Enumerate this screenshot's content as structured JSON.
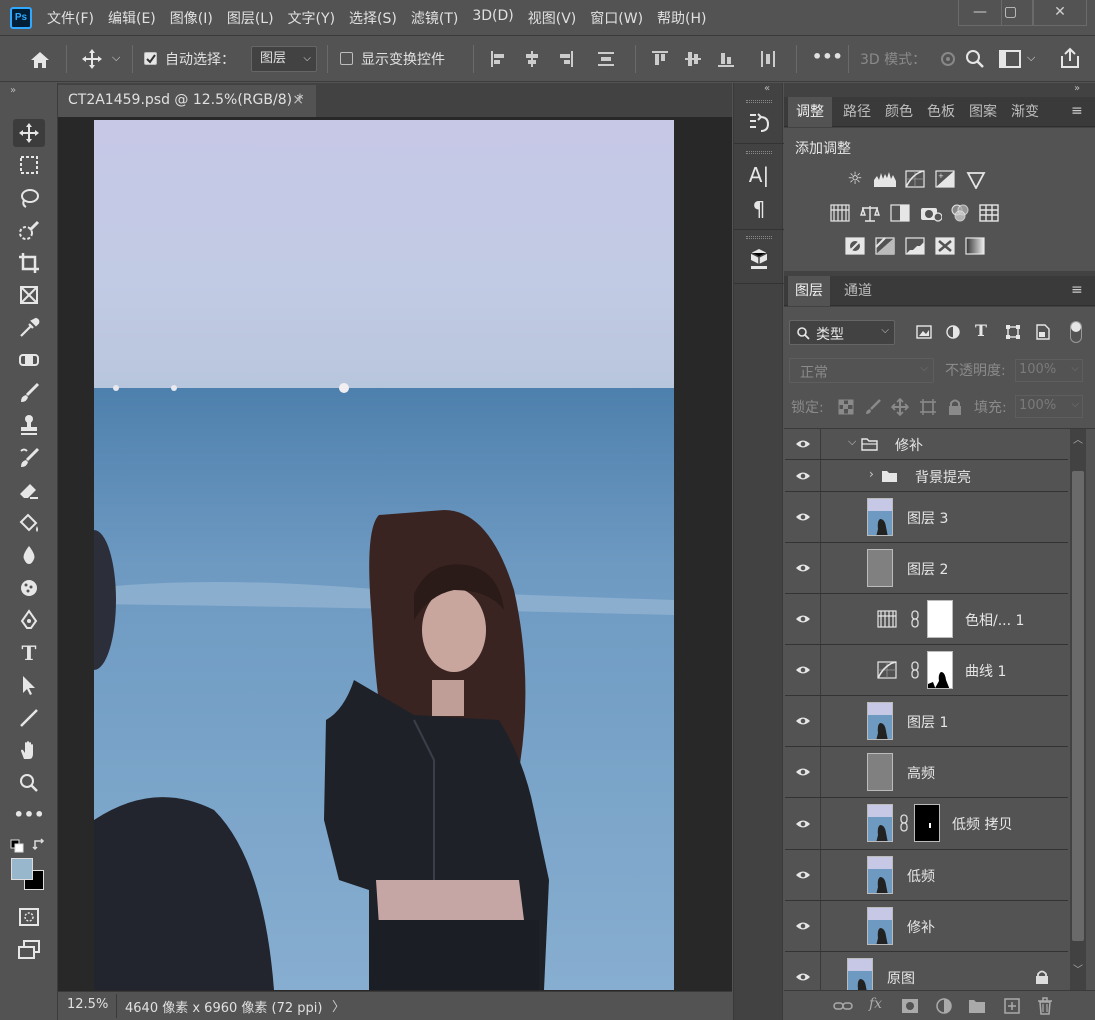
{
  "app": {
    "logo": "Ps"
  },
  "menu": [
    "文件(F)",
    "编辑(E)",
    "图像(I)",
    "图层(L)",
    "文字(Y)",
    "选择(S)",
    "滤镜(T)",
    "3D(D)",
    "视图(V)",
    "窗口(W)",
    "帮助(H)"
  ],
  "window_controls": {
    "minimize": "—",
    "restore": "▢",
    "close": "✕"
  },
  "options": {
    "auto_select_label": "自动选择：",
    "auto_select_checked": true,
    "auto_select_target": "图层",
    "show_transform_label": "显示变换控件",
    "show_transform_checked": false,
    "more": "•••",
    "mode_3d_label": "3D 模式："
  },
  "document": {
    "tab_title": "CT2A1459.psd @ 12.5%(RGB/8) *",
    "close": "×",
    "zoom": "12.5%",
    "info": "4640 像素 x 6960 像素 (72 ppi)",
    "info_arrow": "〉"
  },
  "colors": {
    "foreground": "#98b6cc",
    "background": "#000000",
    "accent": "#31a8ff"
  },
  "adjust_panel": {
    "tabs": [
      "调整",
      "路径",
      "颜色",
      "色板",
      "图案",
      "渐变"
    ],
    "active_tab": "调整",
    "title": "添加调整",
    "icons": [
      [
        "brightness-icon",
        "levels-icon",
        "curves-icon",
        "exposure-icon",
        "vibrance-icon"
      ],
      [
        "hue-saturation-icon",
        "color-balance-icon",
        "black-white-icon",
        "photo-filter-icon",
        "channel-mixer-icon",
        "color-lookup-icon"
      ],
      [
        "invert-icon",
        "posterize-icon",
        "threshold-icon",
        "selective-color-icon",
        "gradient-map-icon"
      ]
    ]
  },
  "layers_panel": {
    "tabs": [
      "图层",
      "通道"
    ],
    "active_tab": "图层",
    "filter_label": "类型",
    "blend_mode": "正常",
    "opacity_label": "不透明度:",
    "opacity_value": "100%",
    "lock_label": "锁定:",
    "fill_label": "填充:",
    "fill_value": "100%",
    "layers": [
      {
        "name": "修补",
        "kind": "group-open",
        "indent": 1
      },
      {
        "name": "背景提亮",
        "kind": "group-closed",
        "indent": 2
      },
      {
        "name": "图层 3",
        "kind": "pixel-photo",
        "indent": 1
      },
      {
        "name": "图层 2",
        "kind": "pixel-gray",
        "indent": 1
      },
      {
        "name": "色相/... 1",
        "kind": "adjust-hue",
        "indent": 1
      },
      {
        "name": "曲线 1",
        "kind": "adjust-curves",
        "indent": 1
      },
      {
        "name": "图层 1",
        "kind": "pixel-photo",
        "indent": 1
      },
      {
        "name": "高频",
        "kind": "pixel-gray",
        "indent": 1
      },
      {
        "name": "低频 拷贝",
        "kind": "pixel-photo-mask",
        "indent": 1
      },
      {
        "name": "低频",
        "kind": "pixel-photo",
        "indent": 1
      },
      {
        "name": "修补",
        "kind": "pixel-photo",
        "indent": 1
      },
      {
        "name": "原图",
        "kind": "pixel-photo-locked",
        "indent": 0
      }
    ],
    "footer_icons": [
      "link-icon",
      "fx-icon",
      "mask-icon",
      "adjustment-icon",
      "folder-icon",
      "new-layer-icon",
      "trash-icon"
    ]
  }
}
